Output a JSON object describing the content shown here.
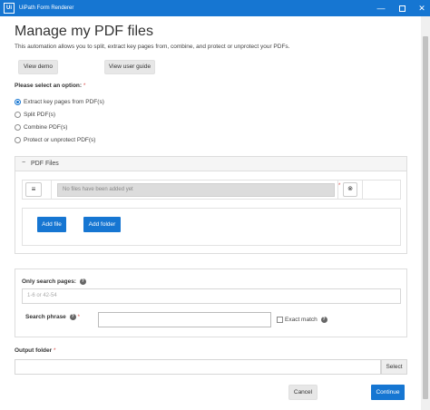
{
  "window": {
    "icon_text": "Ui",
    "title": "UiPath Form Renderer",
    "minimize": "—",
    "maximize": "",
    "close": "✕"
  },
  "header": {
    "title": "Manage my PDF files",
    "description": "This automation allows you to split, extract key pages from, combine, and protect or unprotect your PDFs."
  },
  "buttons": {
    "view_demo": "View demo",
    "view_guide": "View user guide",
    "add_file": "Add file",
    "add_folder": "Add folder",
    "select": "Select",
    "cancel": "Cancel",
    "continue": "Continue"
  },
  "options": {
    "label": "Please select an option:",
    "required_mark": "*",
    "selected_index": 0,
    "items": [
      {
        "label": "Extract key pages from PDF(s)",
        "checked": true
      },
      {
        "label": "Split PDF(s)",
        "checked": false
      },
      {
        "label": "Combine PDF(s)",
        "checked": false
      },
      {
        "label": "Protect or unprotect PDF(s)",
        "checked": false
      }
    ]
  },
  "pdf_panel": {
    "toggle": "−",
    "title": "PDF Files",
    "menu_icon": "≡",
    "file_placeholder": "No files have been added yet",
    "required_mark": "*",
    "remove_icon": "⊗"
  },
  "search": {
    "pages_label": "Only search pages:",
    "pages_placeholder": "1-6 or 42-54",
    "phrase_label": "Search phrase",
    "phrase_required": "*",
    "phrase_value": "",
    "exact_match_label": "Exact match",
    "exact_match_checked": false,
    "help_icon": "?"
  },
  "output": {
    "label": "Output folder",
    "required_mark": "*",
    "value": ""
  },
  "colors": {
    "titlebar": "#1676d2",
    "primary_button": "#1676d2",
    "required": "#d9534f"
  }
}
